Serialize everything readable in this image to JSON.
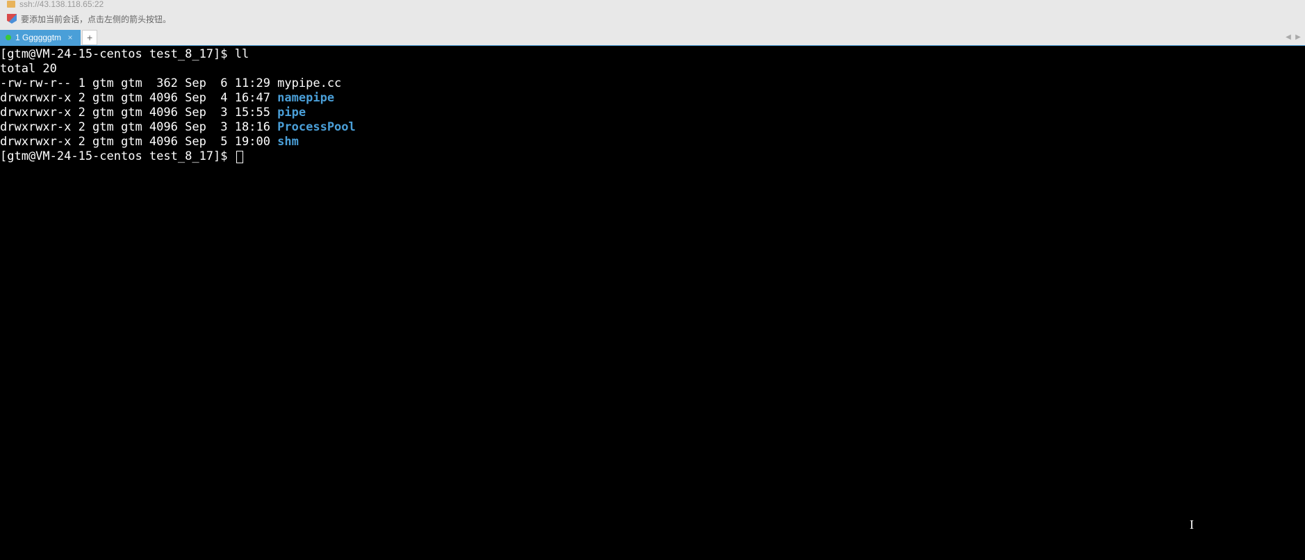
{
  "title_bar": {
    "ssh_address": "ssh://43.138.118.65:22"
  },
  "info_bar": {
    "message": "要添加当前会话，点击左侧的箭头按钮。"
  },
  "tabs": {
    "active_tab": {
      "label": "1 Ggggggtm"
    },
    "close_symbol": "×",
    "add_symbol": "+",
    "nav_left": "◀",
    "nav_right": "▶"
  },
  "terminal": {
    "prompt1": "[gtm@VM-24-15-centos test_8_17]$ ",
    "command1": "ll",
    "total_line": "total 20",
    "entries": [
      {
        "perms": "-rw-rw-r-- 1 gtm gtm  362 Sep  6 11:29 ",
        "name": "mypipe.cc",
        "is_dir": false
      },
      {
        "perms": "drwxrwxr-x 2 gtm gtm 4096 Sep  4 16:47 ",
        "name": "namepipe",
        "is_dir": true
      },
      {
        "perms": "drwxrwxr-x 2 gtm gtm 4096 Sep  3 15:55 ",
        "name": "pipe",
        "is_dir": true
      },
      {
        "perms": "drwxrwxr-x 2 gtm gtm 4096 Sep  3 18:16 ",
        "name": "ProcessPool",
        "is_dir": true
      },
      {
        "perms": "drwxrwxr-x 2 gtm gtm 4096 Sep  5 19:00 ",
        "name": "shm",
        "is_dir": true
      }
    ],
    "prompt2": "[gtm@VM-24-15-centos test_8_17]$ "
  }
}
